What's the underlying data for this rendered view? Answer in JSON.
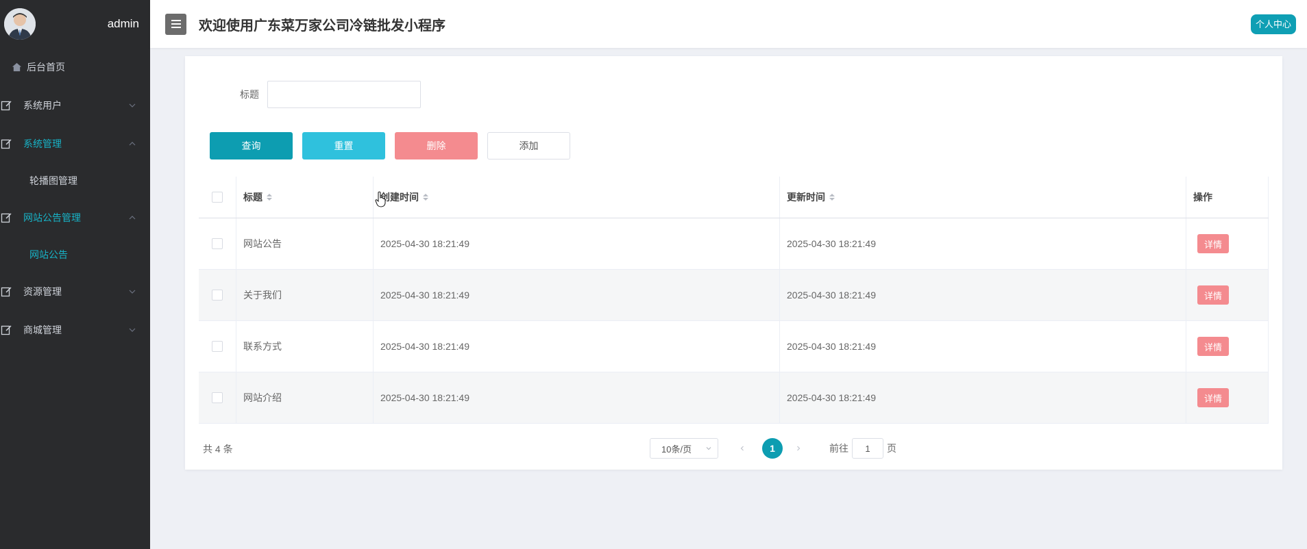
{
  "sidebar": {
    "admin_name": "admin",
    "home": {
      "label": "后台首页",
      "icon": "home-icon"
    },
    "groups": [
      {
        "label": "系统用户",
        "icon": "edit-icon",
        "expanded": false
      },
      {
        "label": "系统管理",
        "icon": "edit-icon",
        "expanded": true,
        "children": [
          {
            "label": "轮播图管理"
          }
        ]
      },
      {
        "label": "网站公告管理",
        "icon": "edit-icon",
        "expanded": true,
        "children": [
          {
            "label": "网站公告"
          }
        ]
      },
      {
        "label": "资源管理",
        "icon": "edit-icon",
        "expanded": false
      },
      {
        "label": "商城管理",
        "icon": "edit-icon",
        "expanded": false
      }
    ]
  },
  "header": {
    "title": "欢迎使用广东菜万家公司冷链批发小程序",
    "user_center": "个人中心"
  },
  "search": {
    "label": "标题",
    "value": "",
    "placeholder": ""
  },
  "buttons": {
    "query": "查询",
    "reset": "重置",
    "delete": "删除",
    "add": "添加"
  },
  "table": {
    "columns": {
      "title": "标题",
      "created": "创建时间",
      "updated": "更新时间",
      "actions": "操作"
    },
    "detail_label": "详情",
    "rows": [
      {
        "title": "网站公告",
        "created": "2025-04-30 18:21:49",
        "updated": "2025-04-30 18:21:49"
      },
      {
        "title": "关于我们",
        "created": "2025-04-30 18:21:49",
        "updated": "2025-04-30 18:21:49"
      },
      {
        "title": "联系方式",
        "created": "2025-04-30 18:21:49",
        "updated": "2025-04-30 18:21:49"
      },
      {
        "title": "网站介绍",
        "created": "2025-04-30 18:21:49",
        "updated": "2025-04-30 18:21:49"
      }
    ]
  },
  "pagination": {
    "total_text": "共 4 条",
    "page_size": "10条/页",
    "current_page": "1",
    "goto_prefix": "前往",
    "goto_value": "1",
    "goto_suffix": "页"
  },
  "colors": {
    "accent": "#0d9db1",
    "danger": "#f48b8f",
    "sidebar_bg": "#2a2b2d"
  }
}
